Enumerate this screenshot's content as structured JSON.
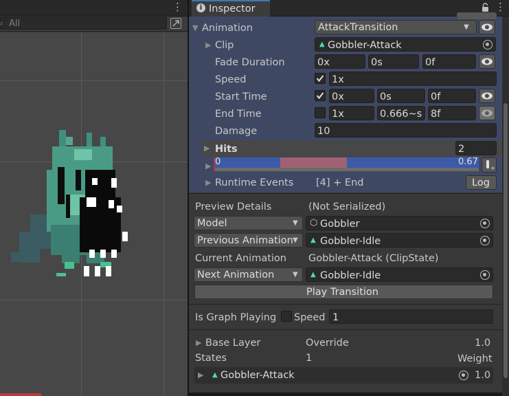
{
  "scene": {
    "search_placeholder": "All"
  },
  "inspector": {
    "tab_title": "Inspector",
    "animation": {
      "label": "Animation",
      "type_value": "AttackTransition",
      "clip": {
        "label": "Clip",
        "value": "Gobbler-Attack"
      },
      "fade_duration": {
        "label": "Fade Duration",
        "x": "0x",
        "s": "0s",
        "f": "0f"
      },
      "speed": {
        "label": "Speed",
        "value": "1x"
      },
      "start_time": {
        "label": "Start Time",
        "x": "0x",
        "s": "0s",
        "f": "0f"
      },
      "end_time": {
        "label": "End Time",
        "x": "1x",
        "s": "0.666~s",
        "f": "8f"
      },
      "damage": {
        "label": "Damage",
        "value": "10"
      },
      "hits": {
        "label": "Hits",
        "value": "2"
      },
      "timeline": {
        "start_label": "0",
        "end_label": "0.67"
      },
      "runtime_events": {
        "label": "Runtime Events",
        "value": "[4] + End",
        "log_button": "Log"
      }
    },
    "preview": {
      "details_label": "Preview Details",
      "details_value": "(Not Serialized)",
      "model_dropdown": "Model",
      "model_value": "Gobbler",
      "previous_dropdown": "Previous Animation",
      "previous_value": "Gobbler-Idle",
      "current_label": "Current Animation",
      "current_value": "Gobbler-Attack (ClipState)",
      "next_dropdown": "Next Animation",
      "next_value": "Gobbler-Idle",
      "play_button": "Play Transition"
    },
    "graph": {
      "playing_label": "Is Graph Playing",
      "speed_label": "Speed",
      "speed_value": "1"
    },
    "layers": {
      "base_layer": "Base Layer",
      "override": "Override",
      "base_weight": "1.0",
      "states_label": "States",
      "states_count": "1",
      "weight_label": "Weight",
      "state_name": "Gobbler-Attack",
      "state_weight": "1.0"
    }
  },
  "colors": {
    "accent": "#3a79bb",
    "section_bg": "#3f4863",
    "clip_icon": "#4ed9b6",
    "timeline_blue": "#3d5aa8",
    "timeline_pink": "#a06272"
  }
}
